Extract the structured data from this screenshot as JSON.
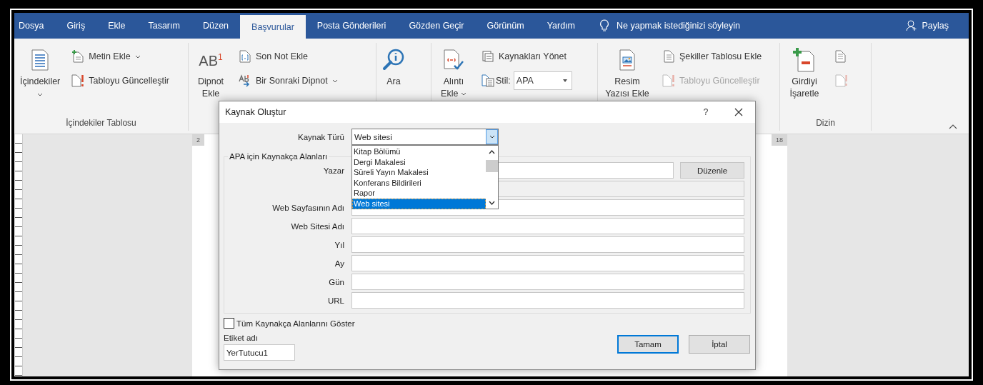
{
  "tabs": [
    {
      "label": "Dosya",
      "selected": false
    },
    {
      "label": "Giriş",
      "selected": false
    },
    {
      "label": "Ekle",
      "selected": false
    },
    {
      "label": "Tasarım",
      "selected": false
    },
    {
      "label": "Düzen",
      "selected": false
    },
    {
      "label": "Başvurular",
      "selected": true
    },
    {
      "label": "Posta Gönderileri",
      "selected": false
    },
    {
      "label": "Gözden Geçir",
      "selected": false
    },
    {
      "label": "Görünüm",
      "selected": false
    },
    {
      "label": "Yardım",
      "selected": false
    }
  ],
  "tell_me": "Ne yapmak istediğinizi söyleyin",
  "share": "Paylaş",
  "ribbon": {
    "groups": [
      {
        "label": "İçindekiler Tablosu",
        "columns": [
          {
            "kind": "large",
            "label": "İçindekiler",
            "dropdown": true
          },
          {
            "kind": "stack",
            "items": [
              {
                "kind": "button",
                "label": "Metin Ekle",
                "dropdown": true,
                "disabled": false
              },
              {
                "kind": "button",
                "label": "Tabloyu Güncelleştir",
                "dropdown": false,
                "disabled": false
              }
            ]
          }
        ]
      },
      {
        "columns": [
          {
            "kind": "large",
            "label": "Dipnot Ekle",
            "glyph": "AB$^{1}$",
            "dropdown": false
          },
          {
            "kind": "stack",
            "items": [
              {
                "kind": "button",
                "label": "Son Not Ekle",
                "dropdown": false,
                "disabled": false
              },
              {
                "kind": "button",
                "label": "Bir Sonraki Dipnot",
                "dropdown": true,
                "disabled": false
              }
            ]
          }
        ]
      },
      {
        "columns": [
          {
            "kind": "large",
            "label": "Ara",
            "dropdown": false
          }
        ]
      },
      {
        "columns": [
          {
            "kind": "large",
            "label": "Alıntı Ekle",
            "dropdown": true
          },
          {
            "kind": "stack",
            "items": [
              {
                "kind": "button",
                "label": "Kaynakları Yönet",
                "dropdown": false,
                "disabled": false
              },
              {
                "kind": "combo",
                "label": "Stil:",
                "value": "APA"
              }
            ]
          }
        ]
      },
      {
        "columns": [
          {
            "kind": "large",
            "label": "Resim Yazısı Ekle",
            "dropdown": false
          },
          {
            "kind": "stack",
            "items": [
              {
                "kind": "button",
                "label": "Şekiller Tablosu Ekle",
                "dropdown": false,
                "disabled": false
              },
              {
                "kind": "button",
                "label": "Tabloyu Güncelleştir",
                "dropdown": false,
                "disabled": true
              }
            ]
          }
        ]
      },
      {
        "label": "Dizin",
        "columns": [
          {
            "kind": "large",
            "label": "Girdiyi İşaretle",
            "dropdown": false
          },
          {
            "kind": "stack",
            "items": [
              {
                "kind": "icon",
                "disabled": false
              },
              {
                "kind": "icon",
                "disabled": true
              }
            ]
          }
        ]
      }
    ]
  },
  "ruler_marks": [
    "2",
    "18"
  ],
  "dialog": {
    "title": "Kaynak Oluştur",
    "help_button": "?",
    "source_type": {
      "label": "Kaynak Türü",
      "value": "Web sitesi",
      "options": [
        {
          "label": "Kitap Bölümü",
          "selected": false
        },
        {
          "label": "Dergi Makalesi",
          "selected": false
        },
        {
          "label": "Süreli Yayın Makalesi",
          "selected": false
        },
        {
          "label": "Konferans Bildirileri",
          "selected": false
        },
        {
          "label": "Rapor",
          "selected": false
        },
        {
          "label": "Web sitesi",
          "selected": true
        }
      ]
    },
    "fields_legend": "APA için Kaynakça Alanları",
    "fields": [
      {
        "kind": "edit",
        "label": "Yazar",
        "button": "Düzenle"
      },
      {
        "kind": "locked"
      },
      {
        "kind": "text",
        "label": "Web Sayfasının Adı"
      },
      {
        "kind": "text",
        "label": "Web Sitesi Adı"
      },
      {
        "kind": "text",
        "label": "Yıl"
      },
      {
        "kind": "text",
        "label": "Ay"
      },
      {
        "kind": "text",
        "label": "Gün"
      },
      {
        "kind": "text",
        "label": "URL"
      }
    ],
    "show_all": {
      "label": "Tüm Kaynakça Alanlarını Göster",
      "checked": false
    },
    "tag_name": {
      "label": "Etiket adı",
      "value": "YerTutucu1"
    },
    "buttons": [
      {
        "label": "Tamam",
        "default": true
      },
      {
        "label": "İptal",
        "default": false
      }
    ]
  }
}
